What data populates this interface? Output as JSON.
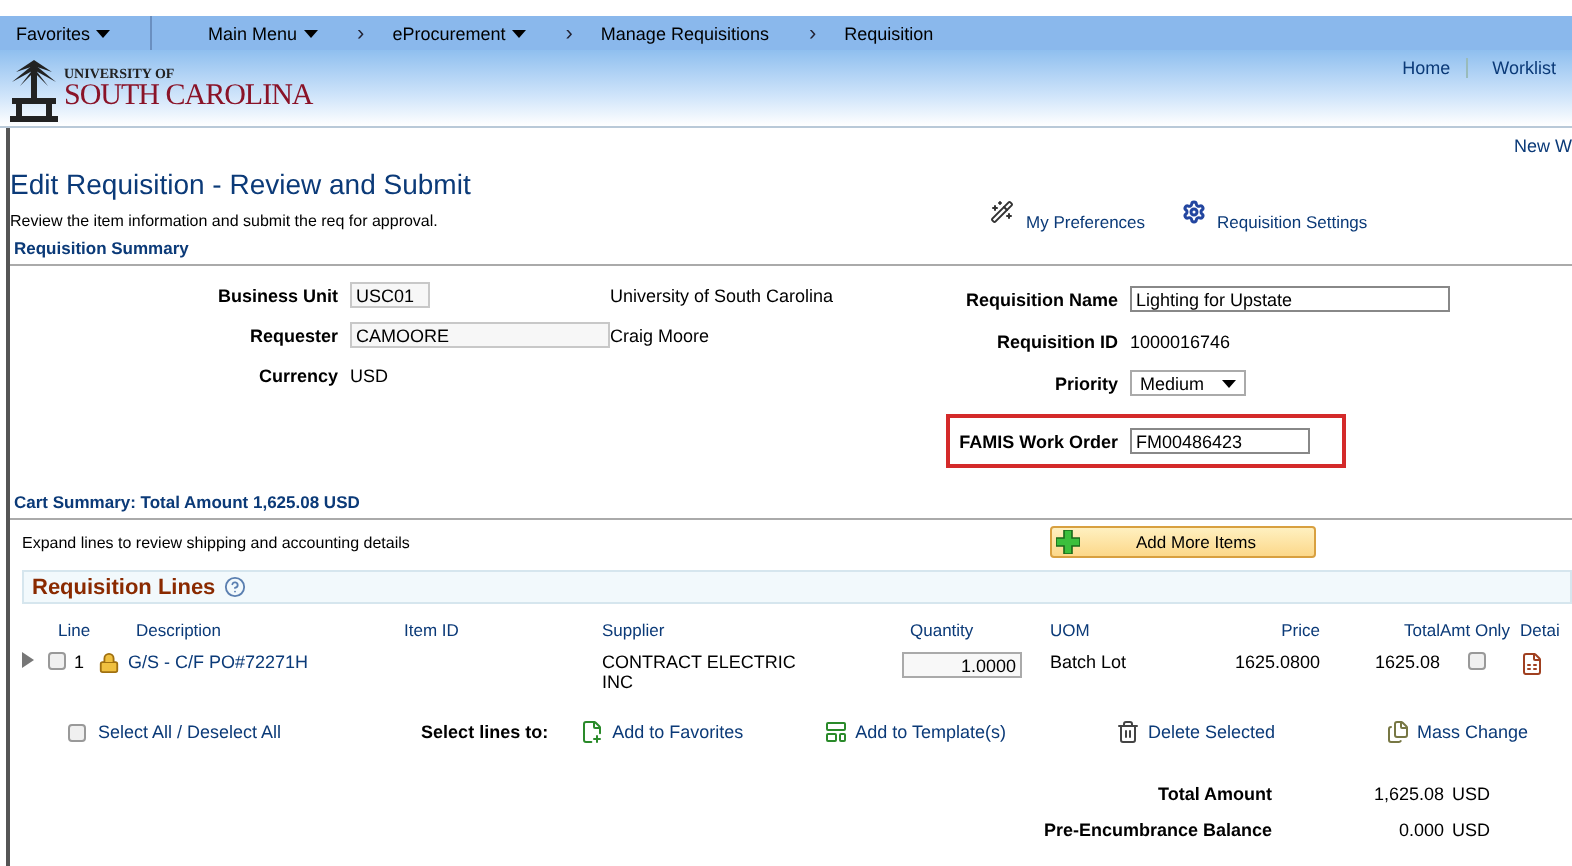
{
  "nav": [
    {
      "label": "Favorites",
      "dropdown": true
    },
    {
      "label": "Main Menu",
      "dropdown": true
    },
    {
      "label": "eProcurement",
      "separator": "›",
      "dropdown": true
    },
    {
      "label": "Manage Requisitions",
      "separator": "›",
      "dropdown": false
    },
    {
      "label": "Requisition",
      "separator": "›",
      "dropdown": false
    }
  ],
  "logo": {
    "line1": "UNIVERSITY OF",
    "line2": "SOUTH CAROLINA"
  },
  "header_links": [
    "Home",
    "Worklist"
  ],
  "new_window_link": "New W",
  "page_title": "Edit Requisition  - Review and Submit",
  "instructions": "Review the item information and submit the req for approval.",
  "tools": [
    {
      "kind": "wand",
      "label": "My Preferences"
    },
    {
      "kind": "gear",
      "label": "Requisition Settings"
    }
  ],
  "summary": {
    "title": "Requisition Summary",
    "left": [
      {
        "label": "Business Unit",
        "kind": "field",
        "value": "USC01",
        "note": "University of South Carolina"
      },
      {
        "label": "Requester",
        "kind": "wide-field",
        "value": "CAMOORE",
        "note": "Craig Moore"
      },
      {
        "label": "Currency",
        "kind": "text",
        "value": "USD"
      }
    ],
    "right": [
      {
        "label": "Requisition Name",
        "kind": "input",
        "value": "Lighting for Upstate",
        "highlighted": false
      },
      {
        "label": "Requisition ID",
        "kind": "text",
        "value": "1000016746",
        "highlighted": false
      },
      {
        "label": "Priority",
        "kind": "select",
        "value": "Medium",
        "highlighted": false
      },
      {
        "label": "FAMIS Work Order",
        "kind": "input",
        "value": "FM00486423",
        "highlighted": true
      }
    ]
  },
  "cart": {
    "title": "Cart Summary: Total Amount 1,625.08 USD",
    "hint": "Expand lines to review shipping and accounting details",
    "add_button": "Add More Items"
  },
  "lines": {
    "title": "Requisition Lines",
    "columns": [
      "Line",
      "Description",
      "Item ID",
      "Supplier",
      "Quantity",
      "UOM",
      "Price",
      "Total",
      "Amt Only",
      "Detai"
    ],
    "rows": [
      {
        "expanded": false,
        "checked": false,
        "line": "1",
        "locked": true,
        "description": "G/S - C/F PO#72271H",
        "supplier": "CONTRACT ELECTRIC INC",
        "quantity": "1.0000",
        "uom": "Batch Lot",
        "price": "1625.0800",
        "total": "1625.08",
        "amt_only": false
      }
    ]
  },
  "select_all": {
    "label": "Select All / Deselect All",
    "checked": false
  },
  "select_lines_label": "Select lines to:",
  "actions": [
    {
      "kind": "favorites",
      "label": "Add to Favorites"
    },
    {
      "kind": "template",
      "label": "Add to Template(s)"
    },
    {
      "kind": "delete",
      "label": "Delete Selected"
    },
    {
      "kind": "mass",
      "label": "Mass Change"
    }
  ],
  "totals": [
    {
      "label": "Total Amount",
      "value": "1,625.08",
      "currency": "USD"
    },
    {
      "label": "Pre-Encumbrance Balance",
      "value": "0.000",
      "currency": "USD"
    }
  ]
}
